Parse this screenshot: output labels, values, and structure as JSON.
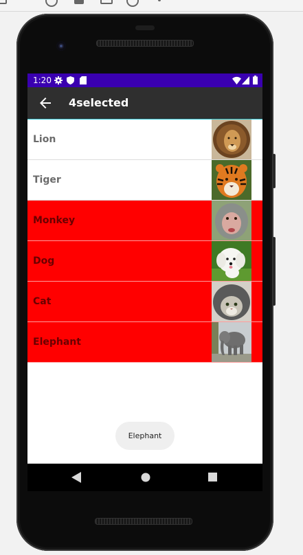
{
  "status_bar": {
    "time": "1:20",
    "background": "#3a00b0",
    "icons": [
      "gear-icon",
      "shield-icon",
      "sd-card-icon",
      "wifi-icon",
      "signal-icon",
      "battery-icon"
    ]
  },
  "app_bar": {
    "title": "4selected",
    "back_icon": "arrow-left-icon",
    "background": "#2f2f2f"
  },
  "list": {
    "selected_color": "#ff0000",
    "items": [
      {
        "label": "Lion",
        "selected": false,
        "image": "lion"
      },
      {
        "label": "Tiger",
        "selected": false,
        "image": "tiger"
      },
      {
        "label": "Monkey",
        "selected": true,
        "image": "monkey"
      },
      {
        "label": "Dog",
        "selected": true,
        "image": "dog"
      },
      {
        "label": "Cat",
        "selected": true,
        "image": "cat"
      },
      {
        "label": "Elephant",
        "selected": true,
        "image": "elephant"
      }
    ]
  },
  "toast": {
    "text": "Elephant"
  },
  "nav_bar": {
    "icons": [
      "back-triangle-icon",
      "home-circle-icon",
      "recents-square-icon"
    ]
  }
}
